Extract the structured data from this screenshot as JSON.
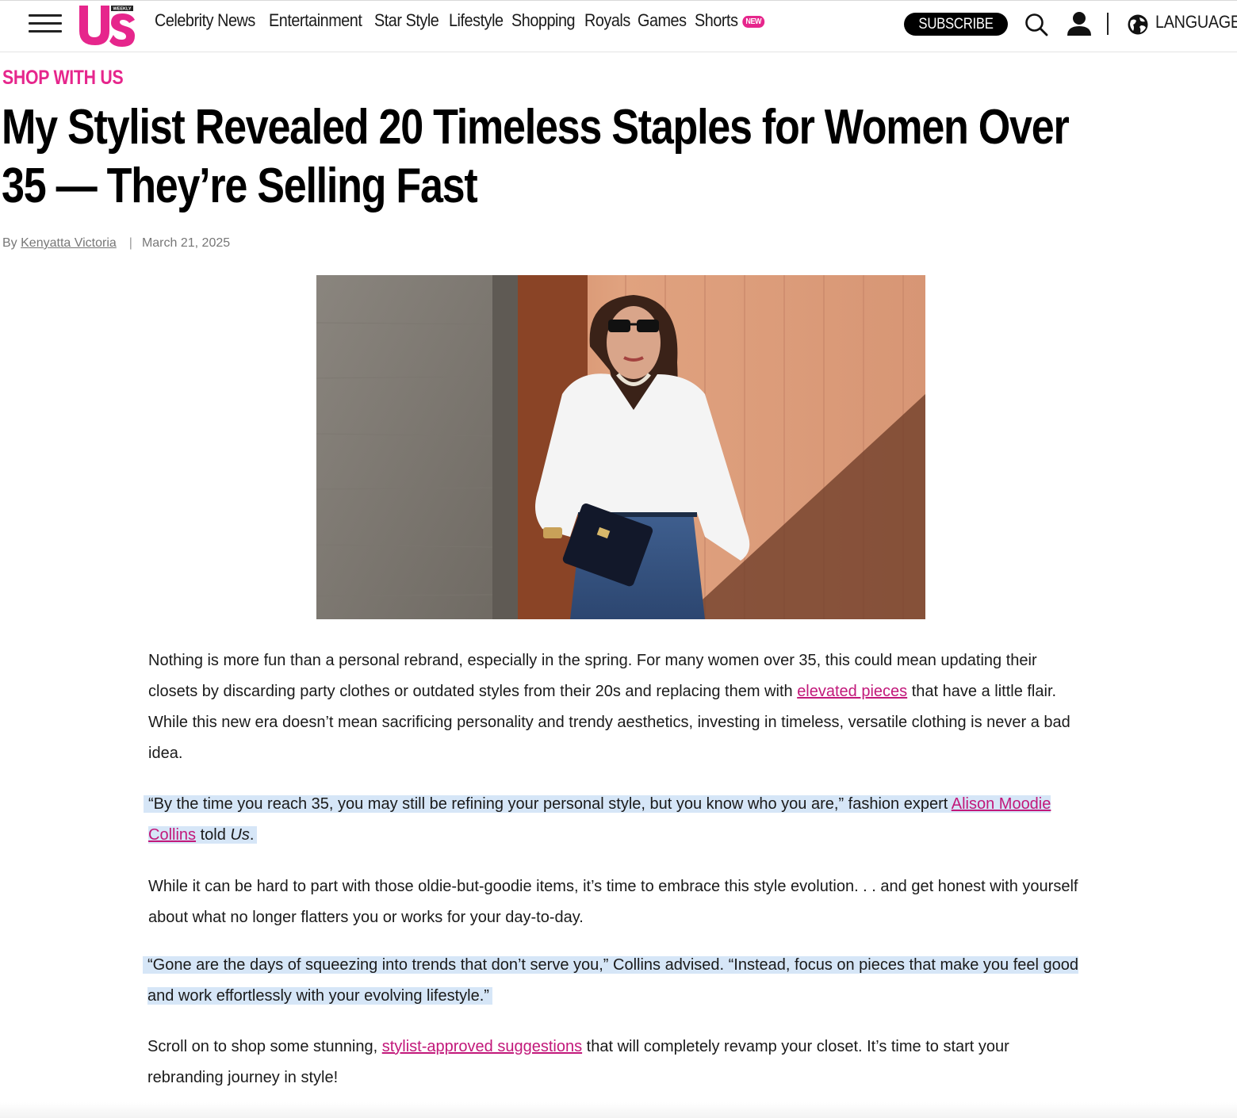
{
  "header": {
    "logo_text": "Us",
    "logo_tag": "WEEKLY",
    "nav": [
      {
        "label": "Celebrity News"
      },
      {
        "label": "Entertainment"
      },
      {
        "label": "Star Style"
      },
      {
        "label": "Lifestyle"
      },
      {
        "label": "Shopping"
      },
      {
        "label": "Royals"
      },
      {
        "label": "Games"
      },
      {
        "label": "Shorts",
        "badge": "NEW"
      }
    ],
    "subscribe_label": "SUBSCRIBE",
    "language_label": "LANGUAGE",
    "icons": [
      "menu-icon",
      "search-icon",
      "user-icon",
      "globe-icon"
    ]
  },
  "article": {
    "kicker": "SHOP WITH US",
    "title": "My Stylist Revealed 20 Timeless Staples for Women Over 35 — They’re Selling Fast",
    "byline_prefix": "By",
    "author": "Kenyatta Victoria",
    "date": "March 21, 2025",
    "paragraphs": {
      "p1_a": "Nothing is more fun than a personal rebrand, especially in the spring. For many women over 35, this could mean updating their closets by discarding party clothes or outdated styles from their 20s and replacing them with ",
      "p1_link": "elevated pieces",
      "p1_b": " that have a little flair. While this new era doesn’t mean sacrificing personality and trendy aesthetics, investing in timeless, versatile clothing is never a bad idea.",
      "p2_a": "“By the time you reach 35, you may still be refining your personal style, but you know who you are,” fashion expert ",
      "p2_link": "Alison Moodie Collins",
      "p2_b": " told ",
      "p2_italic": "Us",
      "p2_c": ".",
      "p3": "While it can be hard to part with those oldie-but-goodie items, it’s time to embrace this style evolution. . . and get honest with yourself about what no longer flatters you or works for your day-to-day.",
      "p4": "“Gone are the days of squeezing into trends that don’t serve you,” Collins advised. “Instead, focus on pieces that make you feel good and work effortlessly with your evolving lifestyle.”",
      "p5_a": "Scroll on to shop some stunning, ",
      "p5_link": "stylist-approved suggestions",
      "p5_b": " that will completely revamp your closet. It’s time to start your rebranding journey in style!"
    }
  },
  "colors": {
    "brand_pink": "#e6268c",
    "link_pink": "#c2187a",
    "highlight": "#d6e6f7"
  }
}
